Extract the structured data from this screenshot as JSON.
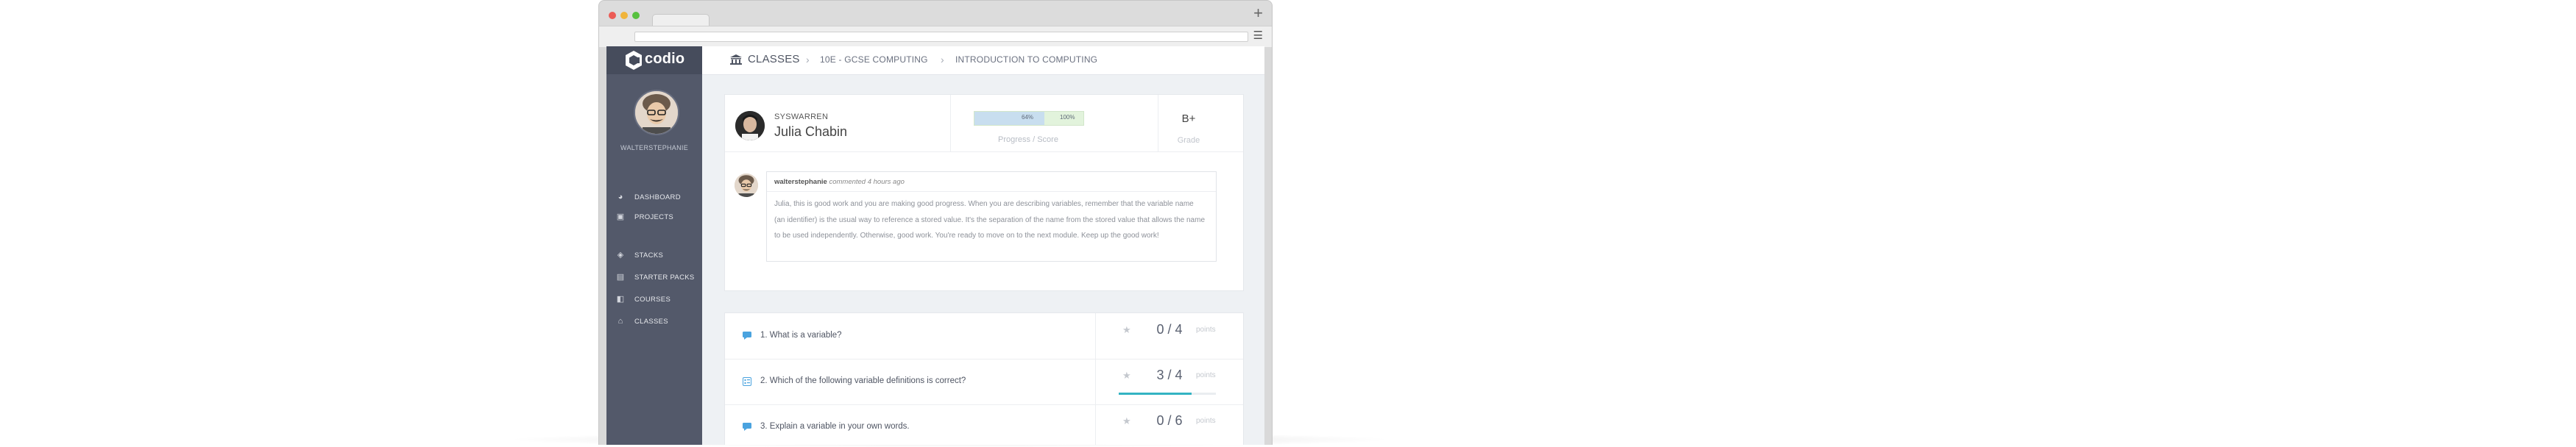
{
  "sidebar": {
    "logo_text": "codio",
    "username": "WALTERSTEPHANIE",
    "nav": [
      {
        "label": "DASHBOARD",
        "icon": "dashboard-icon"
      },
      {
        "label": "PROJECTS",
        "icon": "briefcase-icon"
      },
      {
        "label": "STACKS",
        "icon": "stack-icon"
      },
      {
        "label": "STARTER PACKS",
        "icon": "document-icon"
      },
      {
        "label": "COURSES",
        "icon": "book-icon"
      },
      {
        "label": "CLASSES",
        "icon": "institution-icon"
      }
    ]
  },
  "breadcrumb": {
    "items": [
      "CLASSES",
      "10E - GCSE COMPUTING",
      "INTRODUCTION TO COMPUTING"
    ]
  },
  "student": {
    "username": "SYSWARREN",
    "full_name": "Julia Chabin",
    "progress_label": "64%",
    "progress_fraction": 0.64,
    "score_label": "100%",
    "progress_caption": "Progress / Score",
    "grade": "B+",
    "grade_caption": "Grade"
  },
  "comment": {
    "author": "walterstephanie",
    "meta": "commented 4 hours ago",
    "text": "Julia, this is good work and you are making good progress. When you are describing variables, remember that the variable name (an identifier) is the usual way to reference a stored value. It's the separation of the name from the stored value that allows the name to be used independently. Otherwise, good work. You're ready to move on to the next module. Keep up the good work!"
  },
  "questions": [
    {
      "label": "1. What is a variable?",
      "score": "0 / 4",
      "points_label": "points",
      "icon": "comment-icon",
      "progress": 0
    },
    {
      "label": "2. Which of the following variable definitions is correct?",
      "score": "3 / 4",
      "points_label": "points",
      "icon": "checklist-icon",
      "progress": 0.75
    },
    {
      "label": "3. Explain a variable in your own words.",
      "score": "0 / 6",
      "points_label": "points",
      "icon": "comment-icon",
      "progress": 0
    }
  ],
  "colors": {
    "sidebar": "#53596a",
    "accent": "#33b3c3",
    "progress_blue": "#c8deef",
    "progress_green": "#e2f3dc"
  }
}
